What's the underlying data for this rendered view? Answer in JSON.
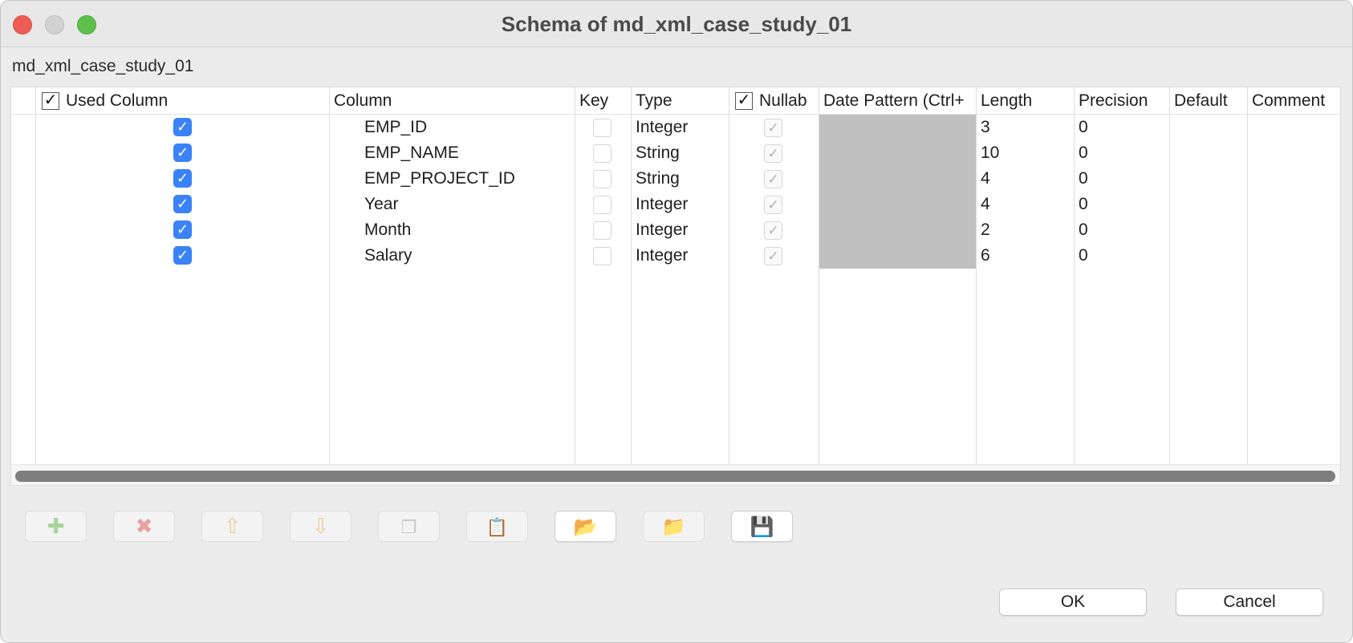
{
  "window": {
    "title": "Schema of md_xml_case_study_01"
  },
  "schema_name": "md_xml_case_study_01",
  "table": {
    "headers": {
      "used_column": "Used Column",
      "column": "Column",
      "key": "Key",
      "type": "Type",
      "nullable": "Nullab",
      "date_pattern": "Date Pattern (Ctrl+",
      "length": "Length",
      "precision": "Precision",
      "default": "Default",
      "comment": "Comment"
    },
    "header_checks": {
      "used_column": "✓",
      "nullable": "✓"
    },
    "rows": [
      {
        "used": true,
        "column": "EMP_ID",
        "key": false,
        "type": "Integer",
        "nullable": true,
        "date_pattern": "",
        "length": "3",
        "precision": "0",
        "default": "",
        "comment": ""
      },
      {
        "used": true,
        "column": "EMP_NAME",
        "key": false,
        "type": "String",
        "nullable": true,
        "date_pattern": "",
        "length": "10",
        "precision": "0",
        "default": "",
        "comment": ""
      },
      {
        "used": true,
        "column": "EMP_PROJECT_ID",
        "key": false,
        "type": "String",
        "nullable": true,
        "date_pattern": "",
        "length": "4",
        "precision": "0",
        "default": "",
        "comment": ""
      },
      {
        "used": true,
        "column": "Year",
        "key": false,
        "type": "Integer",
        "nullable": true,
        "date_pattern": "",
        "length": "4",
        "precision": "0",
        "default": "",
        "comment": ""
      },
      {
        "used": true,
        "column": "Month",
        "key": false,
        "type": "Integer",
        "nullable": true,
        "date_pattern": "",
        "length": "2",
        "precision": "0",
        "default": "",
        "comment": ""
      },
      {
        "used": true,
        "column": "Salary",
        "key": false,
        "type": "Integer",
        "nullable": true,
        "date_pattern": "",
        "length": "6",
        "precision": "0",
        "default": "",
        "comment": ""
      }
    ]
  },
  "toolbar": [
    {
      "name": "add-row-button",
      "icon": "plus-icon",
      "glyph": "✚",
      "cls": "ic-add",
      "enabled": false
    },
    {
      "name": "remove-row-button",
      "icon": "delete-x-icon",
      "glyph": "✖",
      "cls": "ic-del",
      "enabled": false
    },
    {
      "name": "move-up-button",
      "icon": "arrow-up-icon",
      "glyph": "⇧",
      "cls": "ic-up",
      "enabled": false
    },
    {
      "name": "move-down-button",
      "icon": "arrow-down-icon",
      "glyph": "⇩",
      "cls": "ic-down",
      "enabled": false
    },
    {
      "name": "copy-button",
      "icon": "copy-icon",
      "glyph": "❐",
      "cls": "ic-copy",
      "enabled": false
    },
    {
      "name": "paste-button",
      "icon": "paste-icon",
      "glyph": "📋",
      "cls": "ic-paste",
      "enabled": false
    },
    {
      "name": "import-schema-button",
      "icon": "folder-import-icon",
      "glyph": "📂",
      "cls": "ic-import",
      "enabled": true
    },
    {
      "name": "export-schema-button",
      "icon": "folder-export-icon",
      "glyph": "📁",
      "cls": "ic-export",
      "enabled": false
    },
    {
      "name": "save-schema-button",
      "icon": "floppy-disk-icon",
      "glyph": "💾",
      "cls": "ic-save",
      "enabled": true
    }
  ],
  "dialog_buttons": {
    "ok": "OK",
    "cancel": "Cancel"
  }
}
